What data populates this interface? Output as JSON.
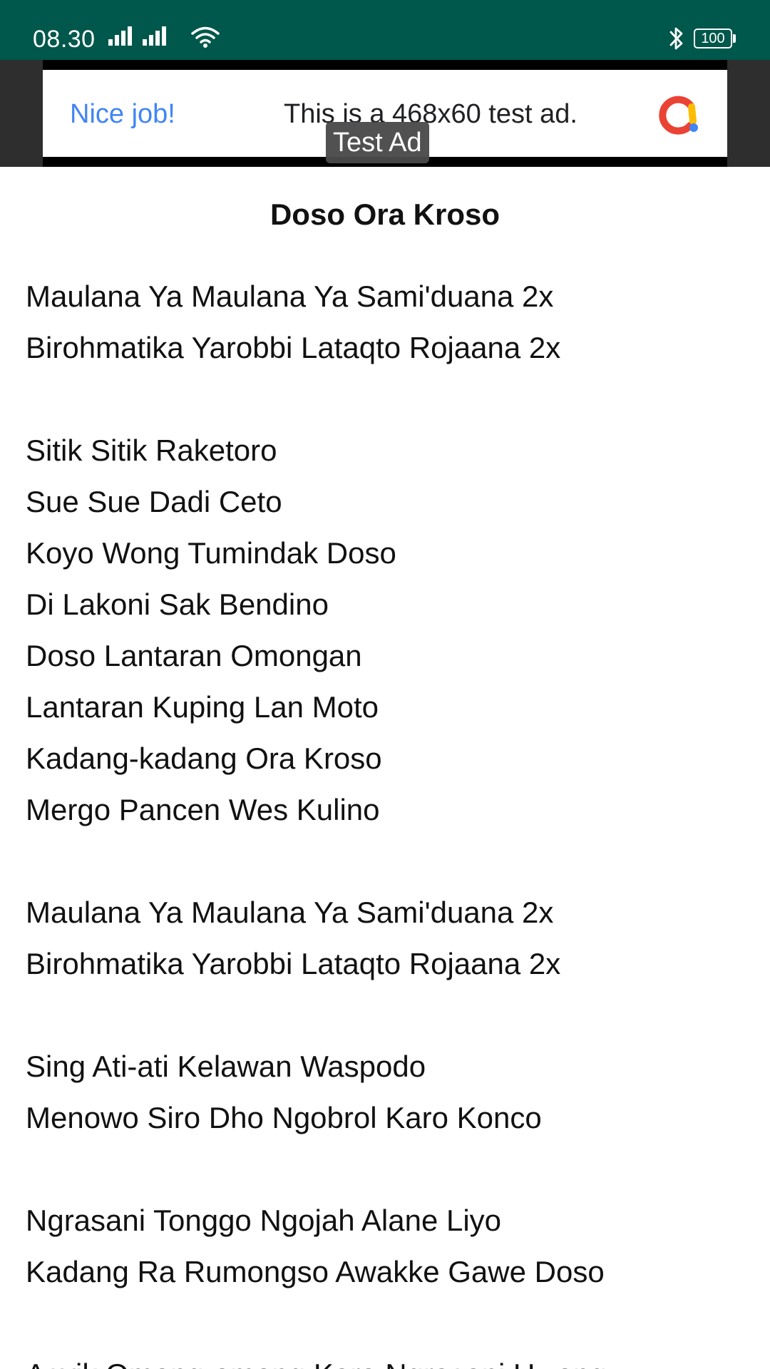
{
  "status_bar": {
    "time": "08.30",
    "battery": "100",
    "background": "#00574b",
    "icons": [
      "signal-icon",
      "signal-icon",
      "wifi-icon",
      "bluetooth-icon",
      "battery-icon"
    ]
  },
  "ad": {
    "label": "Test Ad",
    "headline": "Nice job!",
    "body": "This is a 468x60 test ad.",
    "logo_icon": "admob-logo-icon"
  },
  "song": {
    "title": "Doso Ora Kroso",
    "stanzas": [
      [
        "Maulana Ya Maulana Ya Sami'duana 2x",
        "Birohmatika Yarobbi Lataqto Rojaana 2x"
      ],
      [
        "Sitik Sitik Raketoro",
        "Sue Sue Dadi Ceto",
        "Koyo Wong Tumindak Doso",
        "Di Lakoni Sak Bendino",
        "Doso Lantaran Omongan",
        "Lantaran Kuping Lan Moto",
        "Kadang-kadang Ora Kroso",
        "Mergo Pancen Wes Kulino"
      ],
      [
        "Maulana Ya Maulana Ya Sami'duana 2x",
        "Birohmatika Yarobbi Lataqto Rojaana 2x"
      ],
      [
        "Sing Ati-ati Kelawan Waspodo",
        "Menowo Siro Dho Ngobrol Karo Konco"
      ],
      [
        "Ngrasani Tonggo Ngojah Alane Liyo",
        "Kadang Ra Rumongso Awakke Gawe Doso"
      ],
      [
        "Asyik Omong-omong Karo Ngrasani Uwong"
      ]
    ]
  }
}
